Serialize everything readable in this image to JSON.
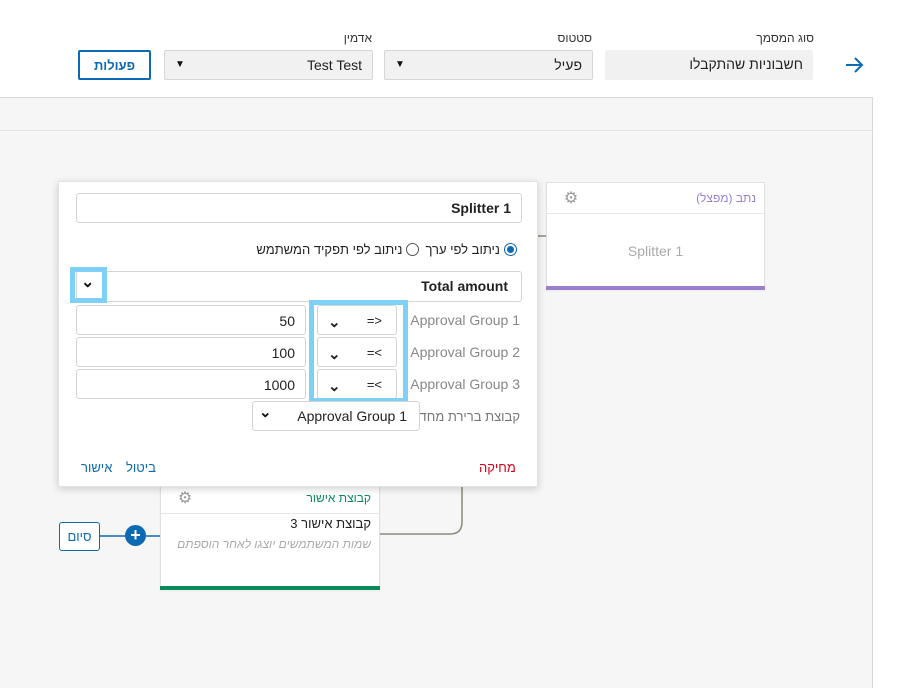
{
  "header": {
    "doc_type_label": "סוג המסמך",
    "doc_type_value": "חשבוניות שהתקבלו",
    "status_label": "סטטוס",
    "status_value": "פעיל",
    "admin_label": "אדמין",
    "admin_value": "Test Test",
    "actions_label": "פעולות",
    "back_icon": "arrow-right-icon"
  },
  "splitter_node": {
    "title": "נתב (מפצל)",
    "body": "Splitter 1",
    "accent": "#9a7fd1"
  },
  "approval_node": {
    "title": "קבוצת אישור",
    "line1": "קבוצת אישור 3",
    "line2": "שמות המשתמשים יוצגו לאחר הוספתם",
    "accent": "#0a8a5a"
  },
  "end_button": "סיום",
  "popup": {
    "name_value": "Splitter 1",
    "radio_value": "ניתוב לפי ערך",
    "radio_role": "ניתוב לפי תפקיד המשתמש",
    "field_value": "Total amount",
    "rules": [
      {
        "group": "Approval Group 1",
        "op": "=>",
        "value": "50"
      },
      {
        "group": "Approval Group 2",
        "op": "=<",
        "value": "100"
      },
      {
        "group": "Approval Group 3",
        "op": "=<",
        "value": "1000"
      }
    ],
    "default_label": "קבוצת ברירת מחדל",
    "default_value": "Approval Group 1",
    "confirm": "אישור",
    "cancel": "ביטול",
    "delete": "מחיקה"
  },
  "colors": {
    "primary": "#0c6ab2",
    "highlight": "#7ed0f6",
    "delete": "#d0021b",
    "splitter_title": "#9a7fd1",
    "approval_title": "#0a8a5a"
  }
}
